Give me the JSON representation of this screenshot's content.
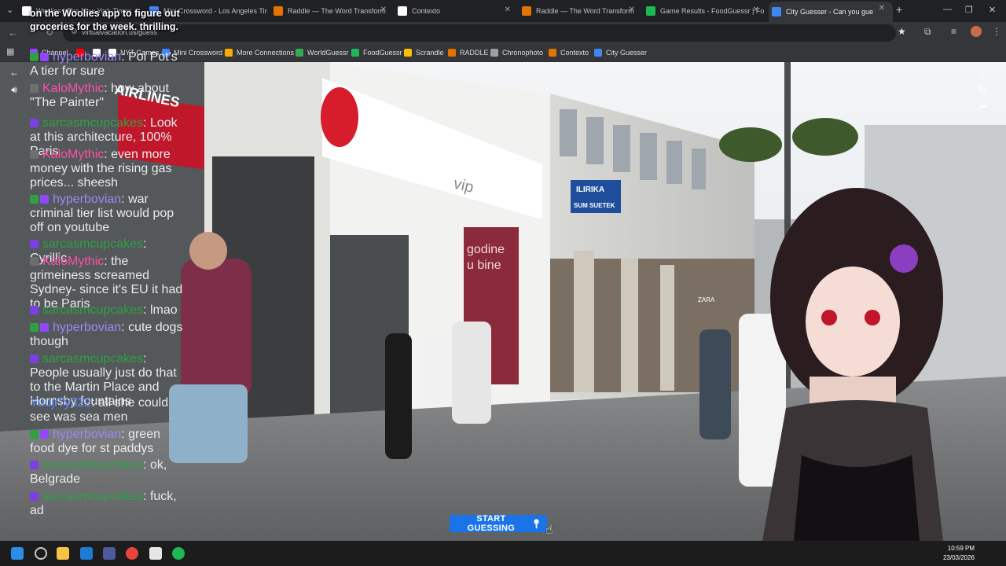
{
  "browser": {
    "tabs": [
      {
        "title": "Woolies | The New York Times",
        "color": "#ffffff"
      },
      {
        "title": "Mini Crossword - Los Angeles Times",
        "color": "#4285f4"
      },
      {
        "title": "Raddle — The Word Transform",
        "color": "#e37400"
      },
      {
        "title": "Contexto",
        "color": "#ffffff"
      },
      {
        "title": "Raddle — The Word Transform",
        "color": "#e37400"
      },
      {
        "title": "Game Results - FoodGuessr | Fo",
        "color": "#1db954"
      },
      {
        "title": "City Guesser - Can you gue",
        "color": "#4285f4",
        "active": true
      }
    ],
    "url": "virtualvacation.us/guess",
    "bookmarks": [
      {
        "label": "Channel",
        "color": "#9146ff"
      },
      {
        "label": "",
        "color": "#ff0000"
      },
      {
        "label": "",
        "color": "#ffffff"
      },
      {
        "label": "NYT Games",
        "color": "#ffffff"
      },
      {
        "label": "Mini Crossword",
        "color": "#4285f4"
      },
      {
        "label": "More Connections",
        "color": "#f9ab00"
      },
      {
        "label": "WorldGuessr",
        "color": "#34a853"
      },
      {
        "label": "FoodGuessr",
        "color": "#1db954"
      },
      {
        "label": "Scrandle",
        "color": "#fbbc04"
      },
      {
        "label": "RADDLE",
        "color": "#e37400"
      },
      {
        "label": "Chronophoto",
        "color": "#9aa0a6"
      },
      {
        "label": "Contexto",
        "color": "#e37400"
      },
      {
        "label": "City Guesser",
        "color": "#4285f4"
      }
    ]
  },
  "overlay": {
    "top_lines": [
      "on the Woolies app to figure out",
      "groceries for the week. thrilling."
    ]
  },
  "chat": [
    {
      "user": "hyperbovian",
      "text": "Pol Pot's A tier for sure",
      "color": "#9b87f5"
    },
    {
      "user": "KaloMythic",
      "text": "how about \"The Painter\"",
      "color": "#ff4fa3"
    },
    {
      "user": "sarcasmcupcakes",
      "text": "Look at this architecture, 100% Paris",
      "color": "#2ea043"
    },
    {
      "user": "KaloMythic",
      "text": "even more money with the rising gas prices... sheesh",
      "color": "#ff4fa3"
    },
    {
      "user": "hyperbovian",
      "text": "war criminal tier list would pop off on youtube",
      "color": "#9b87f5"
    },
    {
      "user": "sarcasmcupcakes",
      "text": "Cyrillic",
      "color": "#2ea043"
    },
    {
      "user": "KaloMythic",
      "text": "the grimeiness screamed Sydney- since it's EU it had to be Paris",
      "color": "#ff4fa3"
    },
    {
      "user": "sarcasmcupcakes",
      "text": "lmao",
      "color": "#2ea043"
    },
    {
      "user": "hyperbovian",
      "text": "cute dogs though",
      "color": "#9b87f5"
    },
    {
      "user": "sarcasmcupcakes",
      "text": "People usually just do that to the Martin Place and Hornsby fountains",
      "color": "#2ea043"
    },
    {
      "user": "YuujiTy322",
      "text": "all she could see was sea men",
      "color": "#5b8cff"
    },
    {
      "user": "hyperbovian",
      "text": "green food dye for st paddys",
      "color": "#9b87f5"
    },
    {
      "user": "sarcasmcupcakes",
      "text": "ok, Belgrade",
      "color": "#2ea043"
    },
    {
      "user": "sarcasmcupcakes",
      "text": "fuck, ad",
      "color": "#2ea043"
    }
  ],
  "scene_signs": {
    "bank": "ILIRIKA",
    "bank_sub": "SUM SUETEK",
    "poster_line1": "godine",
    "poster_line2": "u bine",
    "shop": "vip",
    "store": "ZARA",
    "airline": "AIRLINES"
  },
  "game": {
    "start_button": "START GUESSING"
  },
  "taskbar": {
    "time": "10:59 PM",
    "date": "23/03/2026"
  }
}
